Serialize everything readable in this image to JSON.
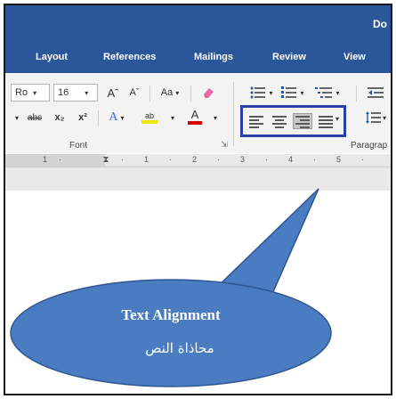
{
  "window": {
    "doc_title": "Do"
  },
  "tabs": [
    "Layout",
    "References",
    "Mailings",
    "Review",
    "View"
  ],
  "font_group": {
    "font_name": "Ro",
    "font_size": "16",
    "grow_glyph": "Aˆ",
    "shrink_glyph": "Aˇ",
    "change_case": "Aa",
    "strikethrough": "abc",
    "subscript": "x₂",
    "superscript": "x²",
    "text_effects": "A",
    "highlight": "ab",
    "font_color": "A",
    "label": "Font"
  },
  "paragraph_group": {
    "label": "Paragrap"
  },
  "alignment": {
    "buttons": [
      "align-left",
      "align-center",
      "align-right",
      "justify"
    ],
    "selected": "align-right"
  },
  "ruler": {
    "ticks": [
      "1",
      "1",
      "2",
      "3",
      "4",
      "5"
    ]
  },
  "callout": {
    "title": "Text Alignment",
    "subtitle": "محاذاة النص",
    "color": "#4a7cc1"
  },
  "colors": {
    "ribbon_blue": "#2b579a",
    "highlight_box": "#2d3ea8",
    "highlight_yellow": "#f2e600",
    "font_red": "#d40000",
    "effects_blue": "#3b6fd8"
  }
}
